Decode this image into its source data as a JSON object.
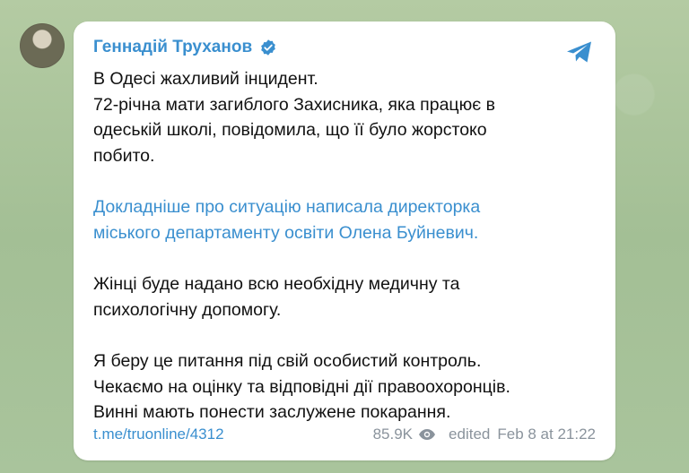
{
  "post": {
    "author": "Геннадій Труханов",
    "paragraphs": [
      [
        "В Одесі жахливий інцидент.",
        "72-річна мати загиблого Захисника, яка працює в",
        "одеській школі, повідомила, що її було жорстоко",
        "побито."
      ],
      [
        "Докладніше про ситуацію написала директорка",
        "міського департаменту освіти Олена Буйневич."
      ],
      [
        "Жінці буде надано всю необхідну медичну та",
        "психологічну допомогу."
      ],
      [
        "Я беру це питання під свій особистий контроль.",
        "Чекаємо на оцінку та відповідні дії правоохоронців.",
        "Винні мають понести заслужене покарання."
      ]
    ],
    "link_url": "t.me/truonline/4312",
    "views": "85.9K",
    "edited_label": "edited",
    "timestamp": "Feb 8 at 21:22"
  },
  "icons": {
    "verified": "verified-badge-icon",
    "share": "telegram-share-icon",
    "views": "eye-icon"
  },
  "colors": {
    "accent": "#3a8fcf",
    "background": "#a9c29a",
    "bubble": "#ffffff",
    "meta_text": "#8a939c"
  }
}
